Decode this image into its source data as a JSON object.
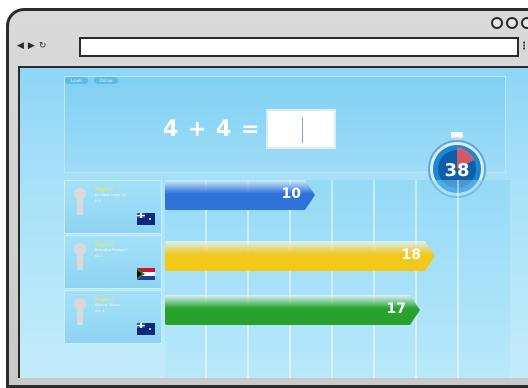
{
  "browser": {
    "nav": {
      "back": "◀",
      "forward": "▶",
      "reload": "↻"
    },
    "menu": "⋮",
    "address": ""
  },
  "page": {
    "tabs": [
      "Level",
      "Online"
    ],
    "question": "4 + 4 =",
    "answer": "",
    "timer": "38",
    "players": [
      {
        "name": "Player 1",
        "lines": [
          "Arr Rose Leger 12",
          "H 3"
        ],
        "flag": "Australia",
        "score": 10
      },
      {
        "name": "Player 2",
        "lines": [
          "Khandisa Phillips 2",
          "Gr 3"
        ],
        "flag": "South Africa",
        "score": 18
      },
      {
        "name": "Player 3",
        "lines": [
          "Walcha Vikkus",
          "Gm 4"
        ],
        "flag": "Australia",
        "score": 17
      }
    ],
    "max_score": 20,
    "colors": {
      "blue_bar": "#2f73d9",
      "yellow_bar": "#f2c81b",
      "green_bar": "#27a22d",
      "bg": "#8fd5f6"
    }
  }
}
